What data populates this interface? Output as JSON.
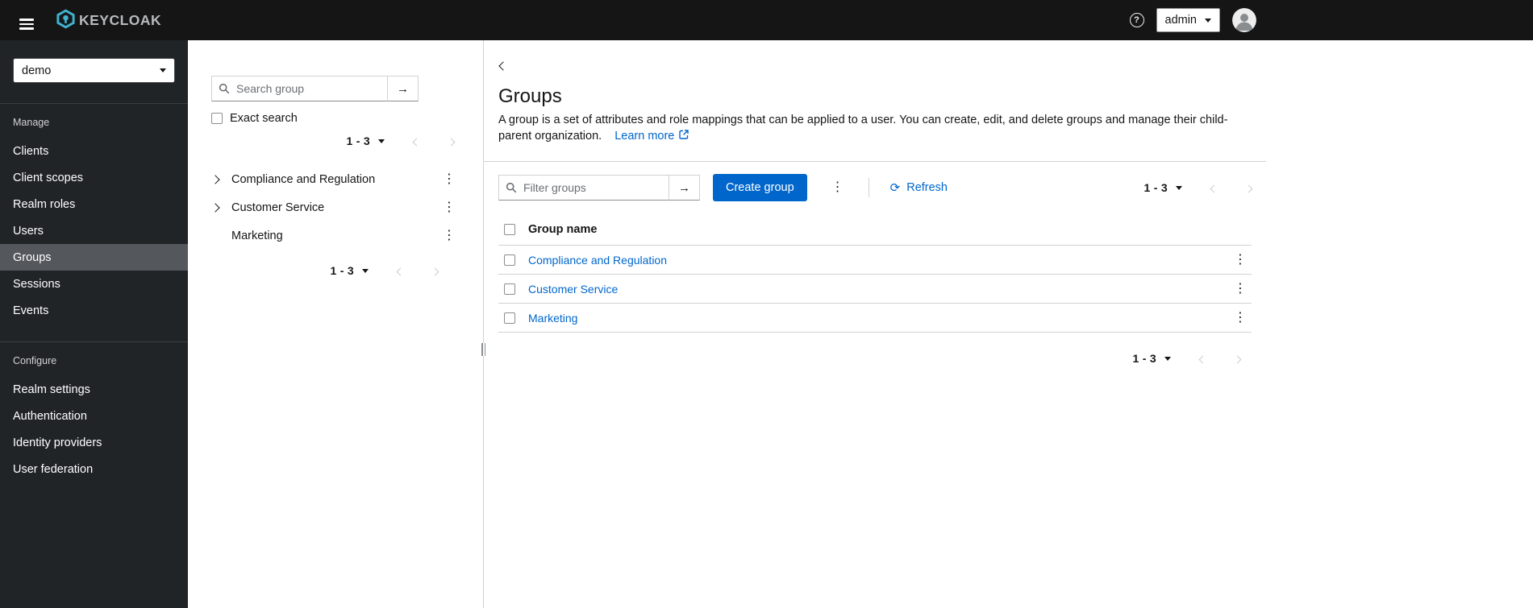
{
  "colors": {
    "primary": "#0066cc",
    "link": "#0066cc",
    "masthead_bg": "#151515",
    "sidebar_bg": "#212427",
    "sidebar_selected_bg": "#54585c",
    "border": "#d2d2d2",
    "brand_icon": "#3fb4cf"
  },
  "masthead": {
    "brand": "KEYCLOAK",
    "user": "admin"
  },
  "sidebar": {
    "realm": "demo",
    "manage_label": "Manage",
    "manage_items": [
      "Clients",
      "Client scopes",
      "Realm roles",
      "Users",
      "Groups",
      "Sessions",
      "Events"
    ],
    "selected_item": "Groups",
    "configure_label": "Configure",
    "configure_items": [
      "Realm settings",
      "Authentication",
      "Identity providers",
      "User federation"
    ]
  },
  "tree": {
    "search_placeholder": "Search group",
    "exact_search_label": "Exact search",
    "pagination_range": "1 - 3",
    "items": [
      {
        "label": "Compliance and Regulation",
        "expandable": true
      },
      {
        "label": "Customer Service",
        "expandable": true
      },
      {
        "label": "Marketing",
        "expandable": false
      }
    ]
  },
  "main": {
    "title": "Groups",
    "description": "A group is a set of attributes and role mappings that can be applied to a user. You can create, edit, and delete groups and manage their child-parent organization.",
    "learn_more_label": "Learn more",
    "filter_placeholder": "Filter groups",
    "create_group_label": "Create group",
    "refresh_label": "Refresh",
    "pagination_range": "1 - 3",
    "table": {
      "name_column": "Group name",
      "rows": [
        "Compliance and Regulation",
        "Customer Service",
        "Marketing"
      ]
    }
  }
}
